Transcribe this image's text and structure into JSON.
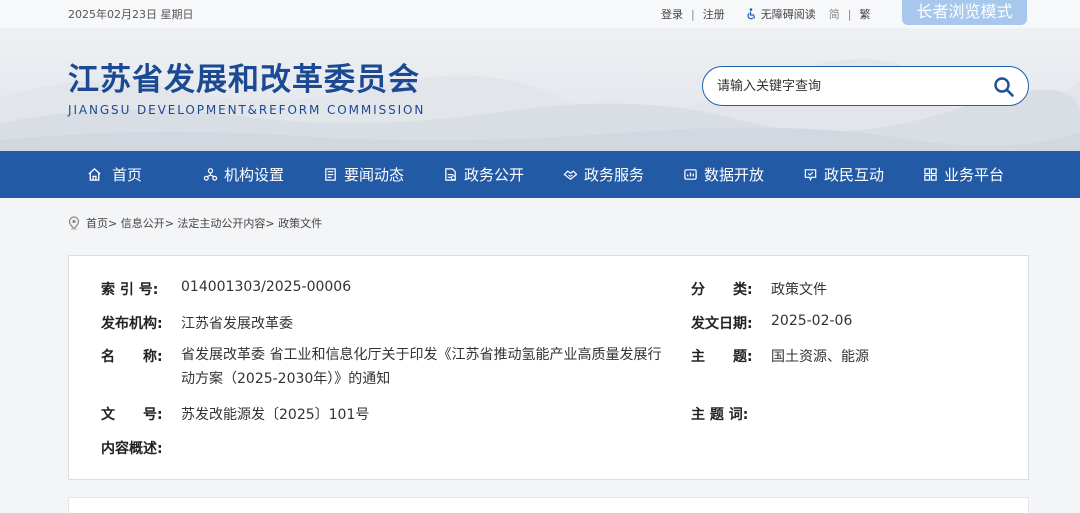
{
  "topbar": {
    "date": "2025年02月23日 星期日",
    "login": "登录",
    "register": "注册",
    "accessible": "无障碍阅读",
    "simplified": "简",
    "traditional": "繁",
    "elder_mode": "长者浏览模式"
  },
  "header": {
    "title": "江苏省发展和改革委员会",
    "subtitle": "JIANGSU DEVELOPMENT&REFORM COMMISSION",
    "search_placeholder": "请输入关键字查询"
  },
  "nav": {
    "items": [
      {
        "label": "首页",
        "icon": "home-icon"
      },
      {
        "label": "机构设置",
        "icon": "org-icon"
      },
      {
        "label": "要闻动态",
        "icon": "news-icon"
      },
      {
        "label": "政务公开",
        "icon": "document-icon"
      },
      {
        "label": "政务服务",
        "icon": "service-icon"
      },
      {
        "label": "数据开放",
        "icon": "data-icon"
      },
      {
        "label": "政民互动",
        "icon": "chat-icon"
      },
      {
        "label": "业务平台",
        "icon": "grid-icon"
      }
    ]
  },
  "breadcrumb": "首页> 信息公开> 法定主动公开内容> 政策文件",
  "info": {
    "index_label": "索 引 号:",
    "index_value": "014001303/2025-00006",
    "publisher_label": "发布机构:",
    "publisher_value": "江苏省发展改革委",
    "name_label": "名　　称:",
    "name_value": "省发展改革委 省工业和信息化厅关于印发《江苏省推动氢能产业高质量发展行动方案（2025-2030年）》的通知",
    "docno_label": "文　　号:",
    "docno_value": "苏发改能源发〔2025〕101号",
    "summary_label": "内容概述:",
    "category_label": "分　　类:",
    "category_value": "政策文件",
    "issue_date_label": "发文日期:",
    "issue_date_value": "2025-02-06",
    "topic_label": "主　　题:",
    "topic_value": "国土资源、能源",
    "keywords_label": "主 题 词:"
  },
  "colors": {
    "nav_bg": "#235aa6",
    "title_blue": "#1b4a93",
    "elder_btn": "#a7c8ec"
  }
}
